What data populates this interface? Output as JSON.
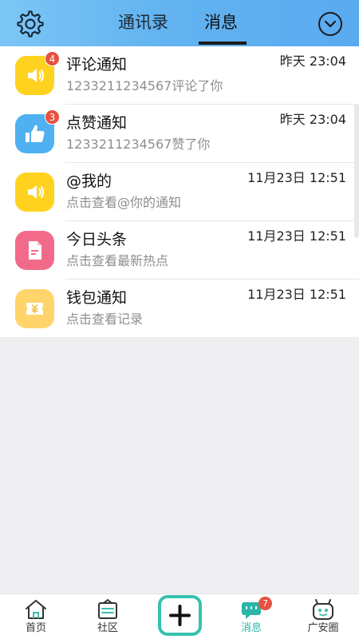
{
  "header": {
    "tabs": [
      {
        "label": "通讯录",
        "active": false
      },
      {
        "label": "消息",
        "active": true
      }
    ],
    "settings_icon": "gear-icon",
    "dropdown_icon": "chevron-down-circle-icon",
    "gradient": [
      "#7cc6f6",
      "#5aaaf0"
    ]
  },
  "notifications": [
    {
      "title": "评论通知",
      "subtitle": "1233211234567评论了你",
      "time": "昨天 23:04",
      "badge": "4",
      "icon": "speaker-icon",
      "color": "#ffd21f"
    },
    {
      "title": "点赞通知",
      "subtitle": "1233211234567赞了你",
      "time": "昨天 23:04",
      "badge": "3",
      "icon": "thumbs-up-icon",
      "color": "#4fb1f2"
    },
    {
      "title": "@我的",
      "subtitle": "点击查看@你的通知",
      "time": "11月23日 12:51",
      "badge": "",
      "icon": "speaker-icon",
      "color": "#ffd21f"
    },
    {
      "title": "今日头条",
      "subtitle": "点击查看最新热点",
      "time": "11月23日 12:51",
      "badge": "",
      "icon": "document-icon",
      "color": "#f26a8a"
    },
    {
      "title": "钱包通知",
      "subtitle": "点击查看记录",
      "time": "11月23日 12:51",
      "badge": "",
      "icon": "wallet-icon",
      "color": "#ffd46a"
    }
  ],
  "bottom_nav": {
    "items": [
      {
        "label": "首页",
        "icon": "home-icon",
        "badge": ""
      },
      {
        "label": "社区",
        "icon": "community-icon",
        "badge": ""
      },
      {
        "label": "消息",
        "icon": "message-icon",
        "badge": "7"
      },
      {
        "label": "广安圈",
        "icon": "robot-icon",
        "badge": ""
      }
    ],
    "add_icon": "plus-icon",
    "active_color": "#2ab6a8",
    "badge_color": "#e8503f"
  }
}
